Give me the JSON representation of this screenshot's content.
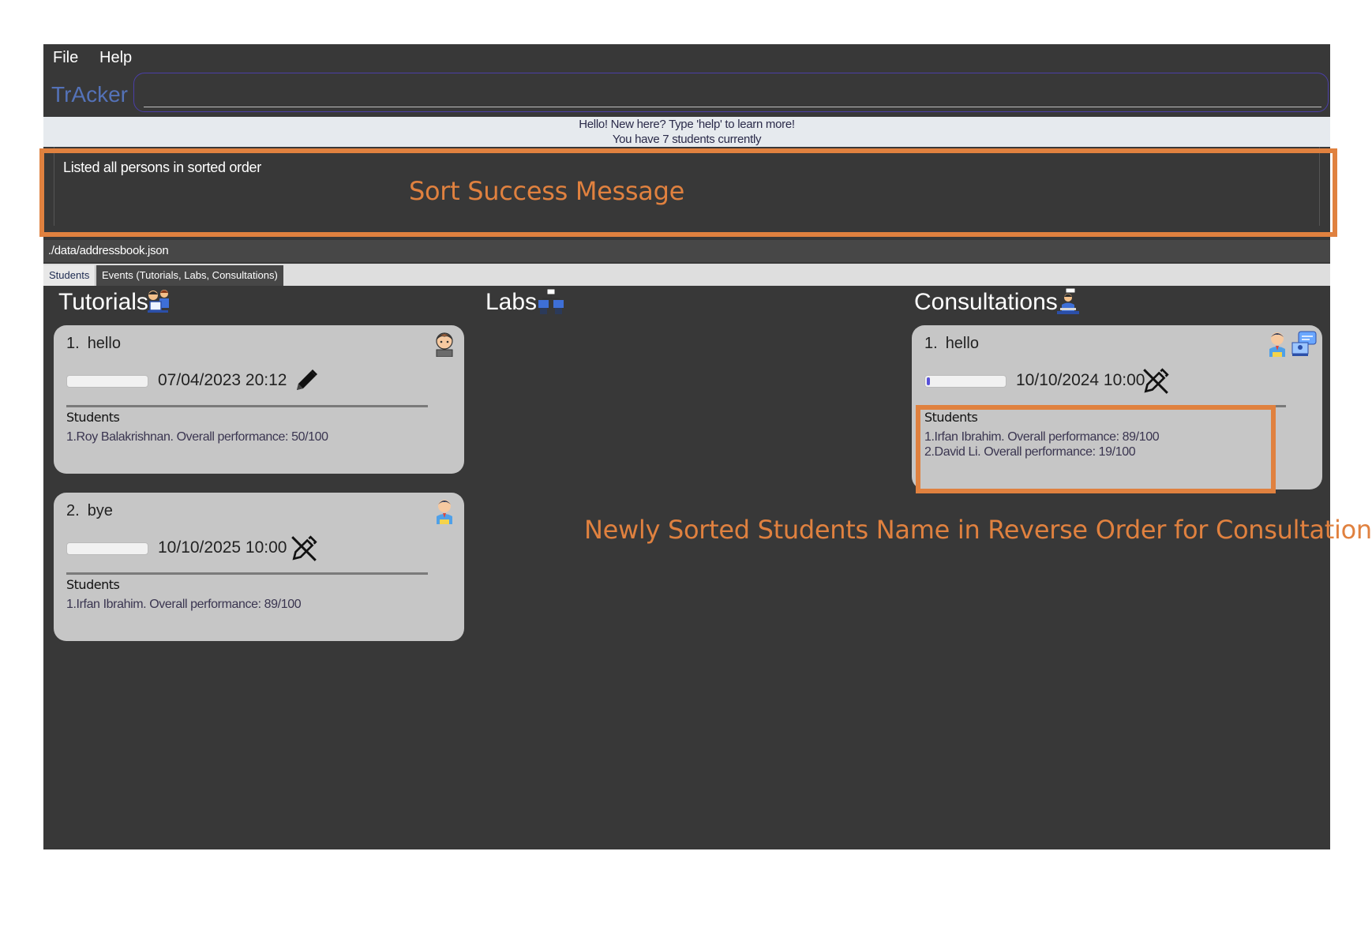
{
  "menu": {
    "file": "File",
    "help": "Help"
  },
  "app_title": "TrAcker",
  "command": {
    "value": "",
    "placeholder": ""
  },
  "greeting": {
    "line1": "Hello! New here? Type 'help' to learn more!",
    "line2": "You have 7 students currently"
  },
  "result_message": "Listed all persons in sorted order",
  "status_path": "./data/addressbook.json",
  "tabs": [
    {
      "label": "Students",
      "active": true
    },
    {
      "label": "Events (Tutorials, Labs, Consultations)",
      "active": false
    }
  ],
  "columns": {
    "tutorials": {
      "title": "Tutorials",
      "icon": "tutorial-icon",
      "cards": [
        {
          "index": "1.",
          "name": "hello",
          "datetime": "07/04/2023 20:12",
          "progress": 0,
          "action_icon": "pencil-icon",
          "avatar": "boy-avatar-icon",
          "section_label": "Students",
          "students": [
            "1.Roy Balakrishnan. Overall performance: 50/100"
          ]
        },
        {
          "index": "2.",
          "name": "bye",
          "datetime": "10/10/2025 10:00",
          "progress": 0,
          "action_icon": "pencil-off-icon",
          "avatar": "student-avatar-icon",
          "section_label": "Students",
          "students": [
            "1.Irfan Ibrahim. Overall performance: 89/100"
          ]
        }
      ]
    },
    "labs": {
      "title": "Labs",
      "icon": "lab-icon",
      "cards": []
    },
    "consultations": {
      "title": "Consultations",
      "icon": "consultation-icon",
      "cards": [
        {
          "index": "1.",
          "name": "hello",
          "datetime": "10/10/2024 10:00",
          "progress": 0.04,
          "action_icon": "pencil-off-icon",
          "avatar": "student-avatar-icon",
          "avatar2": "chat-screen-icon",
          "section_label": "Students",
          "students": [
            "1.Irfan Ibrahim. Overall performance: 89/100",
            "2.David Li. Overall performance: 19/100"
          ]
        }
      ]
    }
  },
  "annotations": {
    "sort_message": "Sort Success Message",
    "sorted_students": "Newly Sorted Students Name in Reverse Order for Consultation",
    "color": "#e0813f"
  },
  "colors": {
    "accent": "#5472b8",
    "background": "#383838",
    "card": "#c6c6c6",
    "progress": "#5750d8"
  }
}
